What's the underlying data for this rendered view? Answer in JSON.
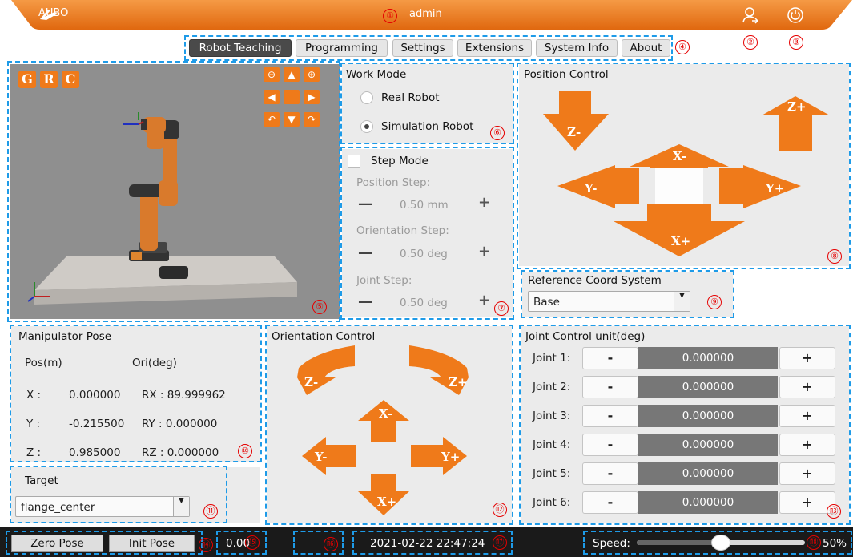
{
  "titlebar": {
    "logo_text": "AUBO",
    "user": "admin"
  },
  "tabs": [
    {
      "label": "Robot Teaching",
      "active": true
    },
    {
      "label": "Programming"
    },
    {
      "label": "Settings"
    },
    {
      "label": "Extensions"
    },
    {
      "label": "System Info"
    },
    {
      "label": "About"
    }
  ],
  "callouts": [
    "①",
    "②",
    "③",
    "④",
    "⑤",
    "⑥",
    "⑦",
    "⑧",
    "⑨",
    "⑩",
    "⑪",
    "⑫",
    "⑬",
    "⑭",
    "⑮",
    "⑯",
    "⑰",
    "⑱"
  ],
  "view3d": {
    "g": "G",
    "r": "R",
    "c": "C"
  },
  "work_mode": {
    "title": "Work Mode",
    "real": "Real Robot",
    "sim": "Simulation Robot",
    "selected": "sim"
  },
  "step_mode": {
    "title": "Step Mode",
    "position_label": "Position Step:",
    "position_value": "0.50 mm",
    "orientation_label": "Orientation Step:",
    "orientation_value": "0.50 deg",
    "joint_label": "Joint Step:",
    "joint_value": "0.50 deg",
    "minus": "—",
    "plus": "+"
  },
  "position_control": {
    "title": "Position Control",
    "z_minus": "Z-",
    "z_plus": "Z+",
    "x_minus": "X-",
    "x_plus": "X+",
    "y_minus": "Y-",
    "y_plus": "Y+"
  },
  "reference": {
    "title": "Reference Coord System",
    "value": "Base"
  },
  "pose": {
    "title": "Manipulator Pose",
    "pos_header": "Pos(m)",
    "ori_header": "Ori(deg)",
    "rows": [
      {
        "axis": "X :",
        "pos": "0.000000",
        "ori": "RX : 89.999962"
      },
      {
        "axis": "Y :",
        "pos": "-0.215500",
        "ori": "RY : 0.000000"
      },
      {
        "axis": "Z :",
        "pos": "0.985000",
        "ori": "RZ : 0.000000"
      }
    ]
  },
  "target": {
    "title": "Target",
    "value": "flange_center"
  },
  "orientation_control": {
    "title": "Orientation Control",
    "z_minus": "Z-",
    "z_plus": "Z+",
    "x_minus": "X-",
    "x_plus": "X+",
    "y_minus": "Y-",
    "y_plus": "Y+"
  },
  "joint_control": {
    "title": "Joint Control  unit(deg)",
    "minus": "-",
    "plus": "+",
    "joints": [
      {
        "label": "Joint 1:",
        "value": "0.000000"
      },
      {
        "label": "Joint 2:",
        "value": "0.000000"
      },
      {
        "label": "Joint 3:",
        "value": "0.000000"
      },
      {
        "label": "Joint 4:",
        "value": "0.000000"
      },
      {
        "label": "Joint 5:",
        "value": "0.000000"
      },
      {
        "label": "Joint 6:",
        "value": "0.000000"
      }
    ]
  },
  "bottom": {
    "zero_pose": "Zero Pose",
    "init_pose": "Init Pose",
    "value": "0.00",
    "datetime": "2021-02-22 22:47:24",
    "speed_label": "Speed:",
    "speed_value": "50%",
    "speed_fraction": 0.5
  },
  "colors": {
    "titlebar": "#ef7a1a",
    "accent_orange": "#ef7a1a",
    "dash_blue": "#1e9be8",
    "callout_red": "#e60000"
  }
}
